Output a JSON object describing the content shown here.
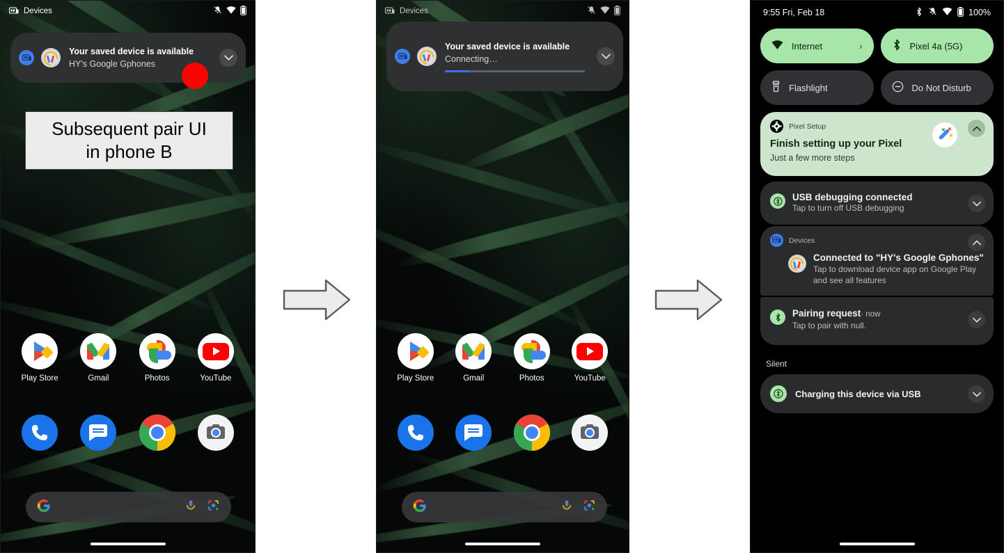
{
  "figure": {
    "caption": "Subsequent pair UI\nin phone B",
    "caption_line1": "Subsequent pair UI",
    "caption_line2": "in phone B",
    "arrow_icon": "right-arrow-icon",
    "highlight_color": "#fb0404"
  },
  "phoneA": {
    "statusbar": {
      "app_label": "Devices",
      "icons": [
        "devices-icon",
        "vibrate-mute-icon",
        "wifi-icon",
        "battery-icon"
      ]
    },
    "notification": {
      "title": "Your saved device is available",
      "subtitle": "HY's Google Gphones",
      "app_icon": "devices-icon",
      "avatar_icon": "earbuds-device-icon",
      "expand_icon": "chevron-down-icon"
    },
    "apps_row1": [
      {
        "label": "Play Store",
        "icon": "play-store-icon"
      },
      {
        "label": "Gmail",
        "icon": "gmail-icon"
      },
      {
        "label": "Photos",
        "icon": "google-photos-icon"
      },
      {
        "label": "YouTube",
        "icon": "youtube-icon"
      }
    ],
    "apps_row2": [
      {
        "label": "Phone",
        "icon": "phone-icon"
      },
      {
        "label": "Messages",
        "icon": "messages-icon"
      },
      {
        "label": "Chrome",
        "icon": "chrome-icon"
      },
      {
        "label": "Camera",
        "icon": "camera-icon"
      }
    ],
    "search": {
      "placeholder": "",
      "google_icon": "google-g-icon",
      "mic_icon": "microphone-icon",
      "lens_icon": "google-lens-icon"
    }
  },
  "phoneB": {
    "statusbar": {
      "app_label": "Devices",
      "icons": [
        "devices-icon",
        "vibrate-mute-icon",
        "wifi-icon",
        "battery-icon"
      ]
    },
    "notification": {
      "title": "Your saved device is available",
      "subtitle": "Connecting…",
      "app_icon": "devices-icon",
      "avatar_icon": "earbuds-device-icon",
      "expand_icon": "chevron-down-icon",
      "progress_percent": 18,
      "progress_color": "#3b72e8"
    },
    "apps_row1": [
      {
        "label": "Play Store",
        "icon": "play-store-icon"
      },
      {
        "label": "Gmail",
        "icon": "gmail-icon"
      },
      {
        "label": "Photos",
        "icon": "google-photos-icon"
      },
      {
        "label": "YouTube",
        "icon": "youtube-icon"
      }
    ],
    "apps_row2": [
      {
        "label": "Phone",
        "icon": "phone-icon"
      },
      {
        "label": "Messages",
        "icon": "messages-icon"
      },
      {
        "label": "Chrome",
        "icon": "chrome-icon"
      },
      {
        "label": "Camera",
        "icon": "camera-icon"
      }
    ],
    "search": {
      "placeholder": "",
      "google_icon": "google-g-icon",
      "mic_icon": "microphone-icon",
      "lens_icon": "google-lens-icon"
    }
  },
  "phoneC": {
    "statusbar": {
      "clock": "9:55 Fri, Feb 18",
      "battery_percent": "100%",
      "icons": [
        "bluetooth-icon",
        "vibrate-mute-icon",
        "wifi-icon",
        "battery-icon"
      ]
    },
    "tiles": [
      {
        "label": "Internet",
        "icon": "wifi-icon",
        "state": "on",
        "caret": "›"
      },
      {
        "label": "Pixel 4a (5G)",
        "icon": "bluetooth-icon",
        "state": "on",
        "caret": ""
      },
      {
        "label": "Flashlight",
        "icon": "flashlight-icon",
        "state": "off",
        "caret": ""
      },
      {
        "label": "Do Not Disturb",
        "icon": "do-not-disturb-icon",
        "state": "off",
        "caret": ""
      }
    ],
    "notifications": [
      {
        "app": "Pixel Setup",
        "app_icon": "settings-gear-icon",
        "title": "Finish setting up your Pixel",
        "subtitle": "Just a few more steps",
        "style": "green",
        "expand_icon": "chevron-up-icon",
        "large_icon": "magic-wand-icon"
      },
      {
        "app": "",
        "app_icon": "usb-icon",
        "title": "USB debugging connected",
        "subtitle": "Tap to turn off USB debugging",
        "style": "dark",
        "expand_icon": "chevron-down-icon"
      },
      {
        "app": "Devices",
        "app_icon": "devices-icon",
        "title": "Connected to \"HY's Google Gphones\"",
        "subtitle": "Tap to download device app on Google Play and see all features",
        "style": "dark-grouped",
        "expand_icon": "chevron-up-icon",
        "avatar_icon": "earbuds-device-icon"
      },
      {
        "app": "",
        "app_icon": "bluetooth-icon",
        "title": "Pairing request",
        "title_suffix": " · now",
        "subtitle": "Tap to pair with null.",
        "style": "dark-grouped2",
        "expand_icon": "chevron-down-icon"
      }
    ],
    "silent_section": {
      "label": "Silent",
      "items": [
        {
          "app_icon": "usb-icon",
          "title": "Charging this device via USB",
          "expand_icon": "chevron-down-icon"
        }
      ]
    }
  }
}
